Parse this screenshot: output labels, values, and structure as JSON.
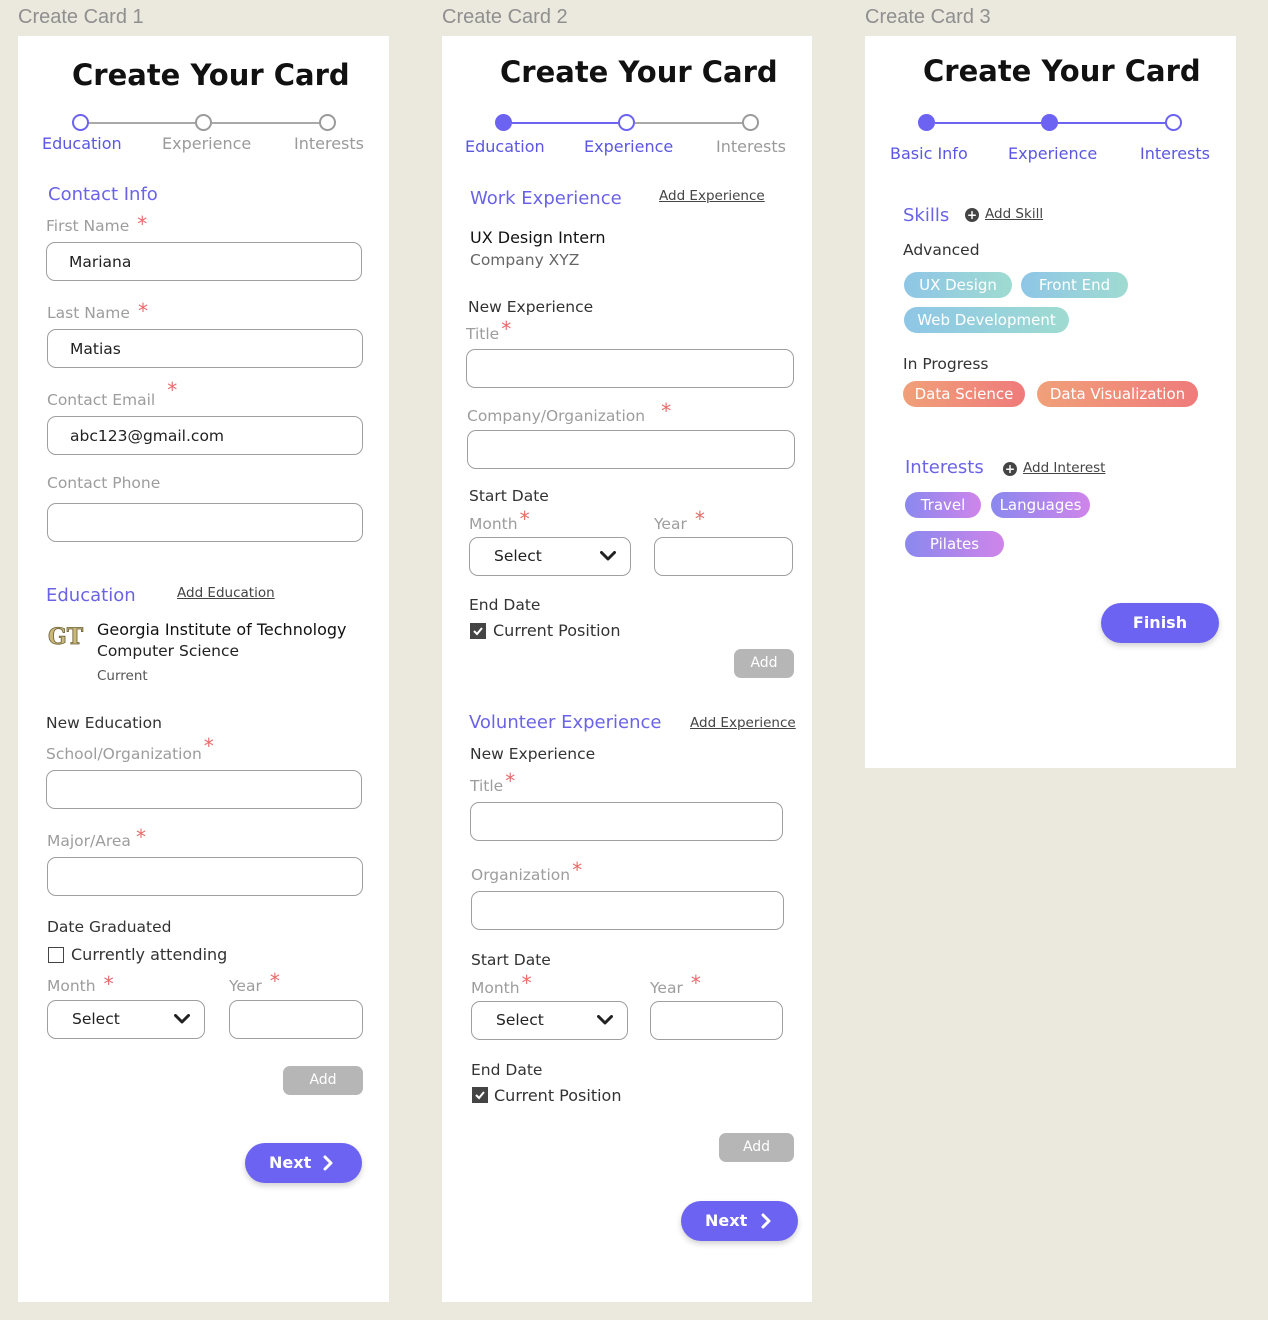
{
  "frames": [
    {
      "label": "Create Card 1"
    },
    {
      "label": "Create Card 2"
    },
    {
      "label": "Create Card 3"
    }
  ],
  "card1": {
    "title": "Create Your Card",
    "steps": [
      "Education",
      "Experience",
      "Interests"
    ],
    "contact_section": "Contact Info",
    "first_name_label": "First Name",
    "first_name_value": "Mariana",
    "last_name_label": "Last Name",
    "last_name_value": "Matias",
    "email_label": "Contact Email",
    "email_value": "abc123@gmail.com",
    "phone_label": "Contact Phone",
    "phone_value": "",
    "education_section": "Education",
    "add_education": "Add Education",
    "school_logo": "GT",
    "school_name": "Georgia Institute of Technology",
    "school_major": "Computer Science",
    "school_status": "Current",
    "new_education": "New Education",
    "school_label": "School/Organization",
    "major_label": "Major/Area",
    "date_graduated": "Date Graduated",
    "currently_attending": "Currently attending",
    "month_label": "Month",
    "year_label": "Year",
    "month_select": "Select",
    "add_button": "Add",
    "next_button": "Next"
  },
  "card2": {
    "title": "Create Your Card",
    "steps": [
      "Education",
      "Experience",
      "Interests"
    ],
    "work_section": "Work Experience",
    "add_experience": "Add Experience",
    "exp_title": "UX Design Intern",
    "exp_company": "Company XYZ",
    "new_experience": "New Experience",
    "title_label": "Title",
    "company_label": "Company/Organization",
    "start_date": "Start Date",
    "month_label": "Month",
    "year_label": "Year",
    "month_select": "Select",
    "end_date": "End Date",
    "current_position": "Current Position",
    "add_button": "Add",
    "volunteer_section": "Volunteer Experience",
    "add_experience_2": "Add Experience",
    "new_experience_2": "New Experience",
    "title_label_2": "Title",
    "organization_label": "Organization",
    "start_date_2": "Start Date",
    "month_label_2": "Month",
    "year_label_2": "Year",
    "month_select_2": "Select",
    "end_date_2": "End Date",
    "current_position_2": "Current Position",
    "add_button_2": "Add",
    "next_button": "Next"
  },
  "card3": {
    "title": "Create Your Card",
    "steps": [
      "Basic Info",
      "Experience",
      "Interests"
    ],
    "skills_section": "Skills",
    "add_skill": "Add Skill",
    "advanced_label": "Advanced",
    "advanced_skills": [
      "UX Design",
      "Front End",
      "Web Development"
    ],
    "in_progress_label": "In Progress",
    "in_progress_skills": [
      "Data Science",
      "Data Visualization"
    ],
    "interests_section": "Interests",
    "add_interest": "Add Interest",
    "interests": [
      "Travel",
      "Languages",
      "Pilates"
    ],
    "finish_button": "Finish"
  },
  "colors": {
    "accent": "#6c63f2",
    "background": "#ebe8dd",
    "required": "#e86a6a",
    "disabled_button": "#b6b6b6"
  }
}
